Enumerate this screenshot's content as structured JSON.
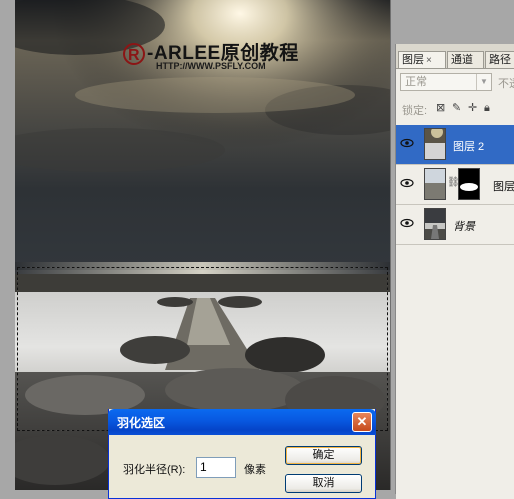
{
  "watermark": {
    "logo_symbol": "R",
    "title": "-ARLEE原创教程",
    "url": "HTTP://WWW.PSFLY.COM"
  },
  "layers_panel": {
    "tabs": [
      {
        "label": "图层",
        "close": "×"
      },
      {
        "label": "通道"
      },
      {
        "label": "路径"
      }
    ],
    "blend_mode": "正常",
    "opacity_label": "不透",
    "lock_label": "锁定:",
    "layers": [
      {
        "name": "图层 2",
        "selected": true,
        "visible": true
      },
      {
        "name": "图层",
        "selected": false,
        "visible": true,
        "has_mask": true
      },
      {
        "name": "背景",
        "selected": false,
        "visible": true
      }
    ]
  },
  "feather_dialog": {
    "title": "羽化选区",
    "close_glyph": "✕",
    "radius_label": "羽化半径(R):",
    "radius_value": "1",
    "unit": "像素",
    "ok_label": "确定",
    "cancel_label": "取消"
  },
  "colors": {
    "selected_layer": "#316ac5",
    "dialog_title_blue": "#0858e0",
    "close_button": "#c64a1c"
  }
}
